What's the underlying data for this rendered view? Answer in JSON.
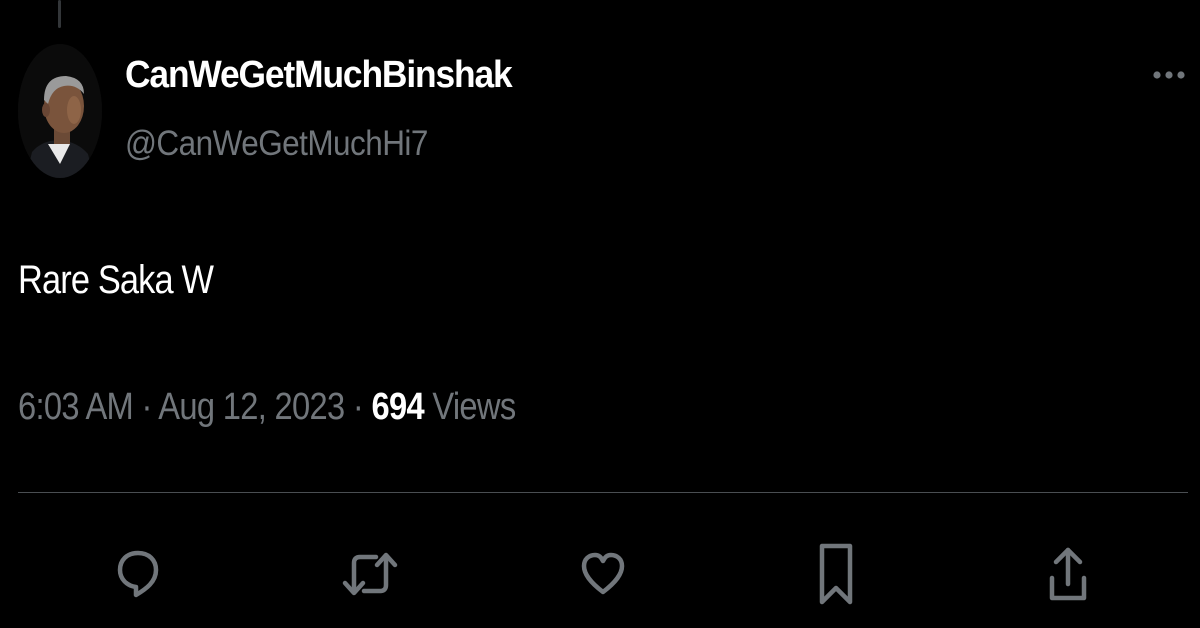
{
  "tweet": {
    "author": {
      "display_name": "CanWeGetMuchBinshak",
      "handle": "@CanWeGetMuchHi7",
      "avatar_icon": "profile-photo"
    },
    "text": "Rare Saka W",
    "time": "6:03 AM",
    "separator": "·",
    "date": "Aug 12, 2023",
    "views_count": "694",
    "views_label": "Views"
  },
  "actions": [
    {
      "name": "reply",
      "icon": "speech-bubble-icon"
    },
    {
      "name": "retweet",
      "icon": "retweet-arrows-icon"
    },
    {
      "name": "like",
      "icon": "heart-icon"
    },
    {
      "name": "bookmark",
      "icon": "bookmark-icon"
    },
    {
      "name": "share",
      "icon": "share-upload-icon"
    }
  ],
  "more_icon": "ellipsis-icon",
  "colors": {
    "background": "#000000",
    "primary_text": "#ffffff",
    "secondary_text": "#71767b",
    "icon": "#71767b",
    "divider": "#4a4e52"
  }
}
